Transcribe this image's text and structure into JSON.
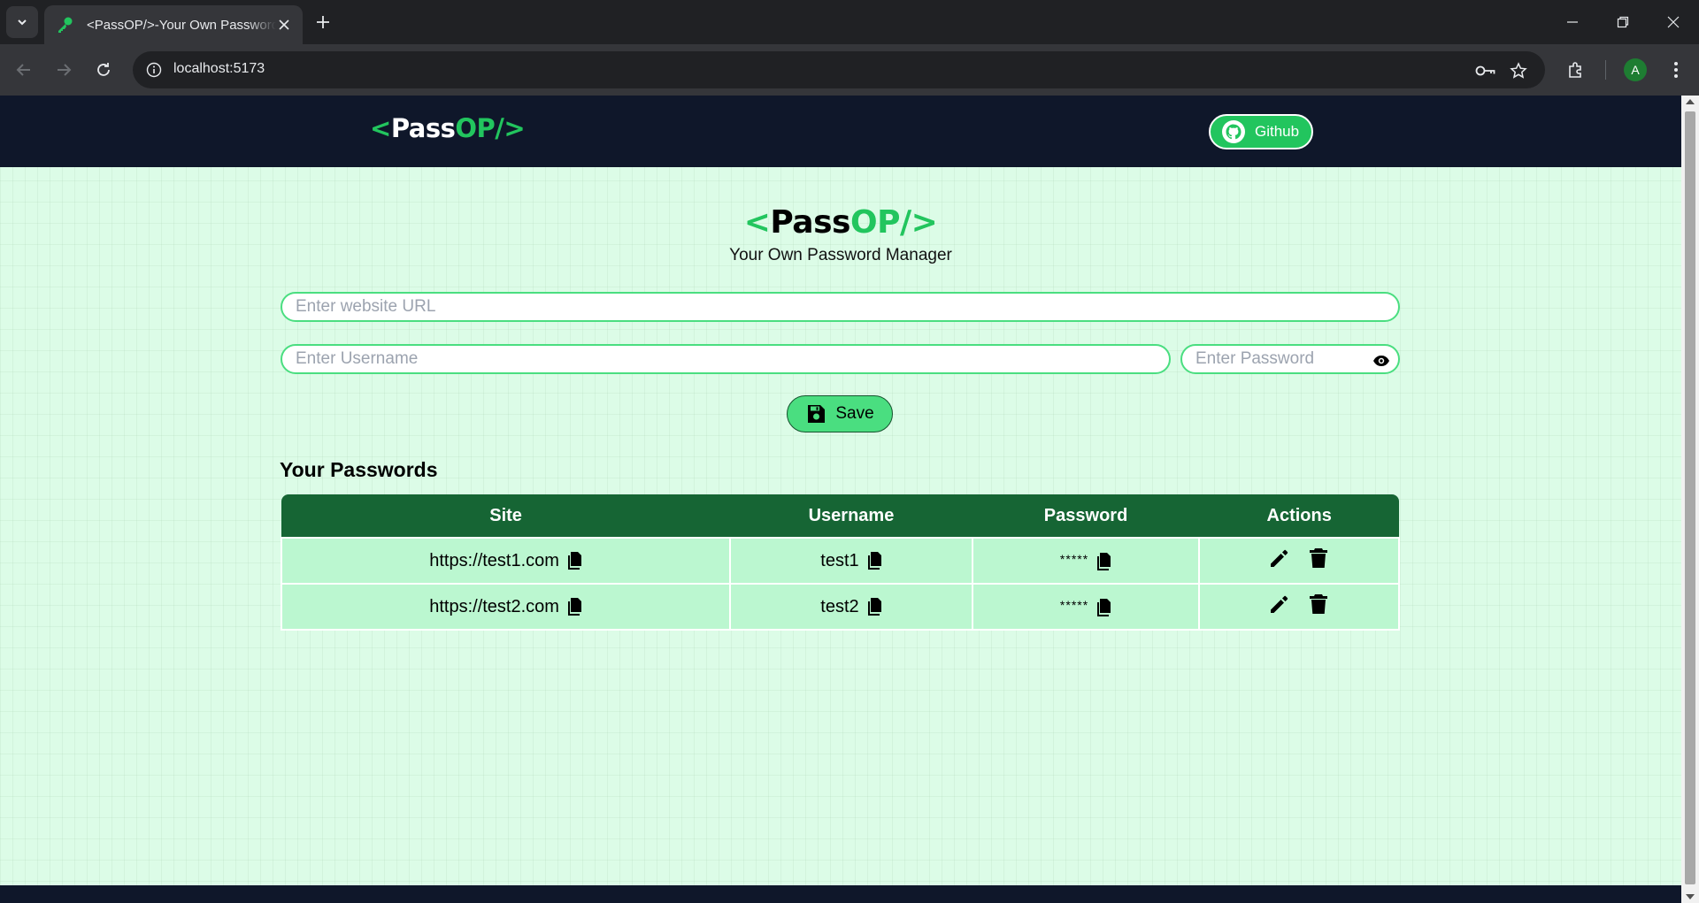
{
  "browser": {
    "tab_title": "<PassOP/>-Your Own Password Manager",
    "url": "localhost:5173",
    "profile_initial": "A"
  },
  "navbar": {
    "brand_open": "<",
    "brand_pass": "Pass",
    "brand_op": "OP/>",
    "github_label": "Github"
  },
  "hero": {
    "title_open": "<",
    "title_pass": "Pass",
    "title_op": "OP/>",
    "subtitle": "Your Own Password Manager"
  },
  "form": {
    "url_placeholder": "Enter website URL",
    "username_placeholder": "Enter Username",
    "password_placeholder": "Enter Password",
    "save_label": "Save"
  },
  "passwords": {
    "section_title": "Your Passwords",
    "headers": [
      "Site",
      "Username",
      "Password",
      "Actions"
    ],
    "rows": [
      {
        "site": "https://test1.com",
        "username": "test1",
        "password": "*****"
      },
      {
        "site": "https://test2.com",
        "username": "test2",
        "password": "*****"
      }
    ]
  },
  "colors": {
    "accent": "#22c55e",
    "navbar_bg": "#0f172a",
    "table_header_bg": "#166534",
    "table_cell_bg": "#bbf7d0",
    "page_bg": "#dcfce7"
  }
}
